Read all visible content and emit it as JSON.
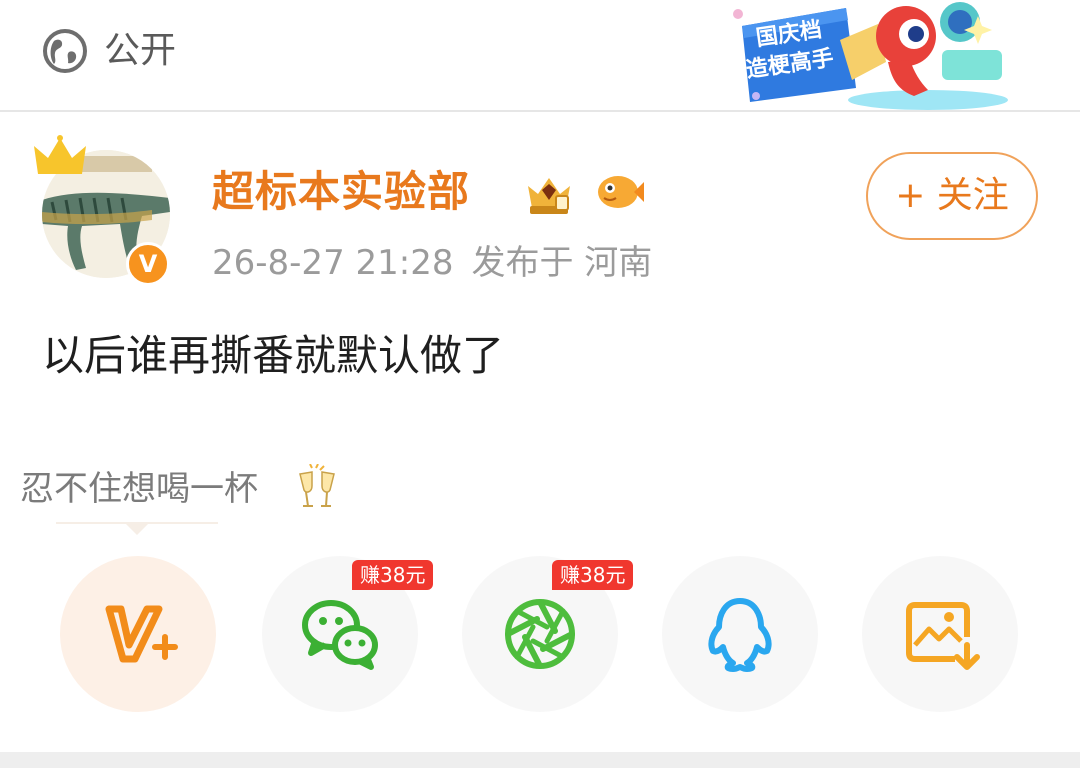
{
  "header": {
    "visibility_label": "公开",
    "visibility_icon": "globe-icon",
    "banner": {
      "line1": "国庆档",
      "line2": "造梗高手",
      "icon": "mascot-illustration"
    }
  },
  "post": {
    "author": {
      "name": "超标本实验部",
      "avatar_icon": "avatar-dinosaur",
      "verified_badge": "V",
      "badges": [
        "vip-crown-badge",
        "fish-badge"
      ]
    },
    "date": "26-8-27 21:28",
    "location": "发布于 河南",
    "follow_label": "+ 关注",
    "content": "以后谁再撕番就默认做了"
  },
  "share_panel": {
    "prompt": "忍不住想喝一杯",
    "prompt_emoji": "champagne-glasses-icon",
    "items": [
      {
        "name": "vplus",
        "icon": "v-plus-icon",
        "color": "#f28c1a",
        "reward": ""
      },
      {
        "name": "wechat",
        "icon": "wechat-icon",
        "color": "#3cb034",
        "reward": "赚38元"
      },
      {
        "name": "moments",
        "icon": "moments-shutter-icon",
        "color": "#4ebd3d",
        "reward": "赚38元"
      },
      {
        "name": "qq",
        "icon": "qq-penguin-icon",
        "color": "#2aa7ef",
        "reward": ""
      },
      {
        "name": "save-image",
        "icon": "save-image-icon",
        "color": "#f5a623",
        "reward": ""
      }
    ]
  },
  "colors": {
    "accent": "#e8791d",
    "reward_badge": "#f0372e",
    "meta_text": "#9b9b9b"
  }
}
